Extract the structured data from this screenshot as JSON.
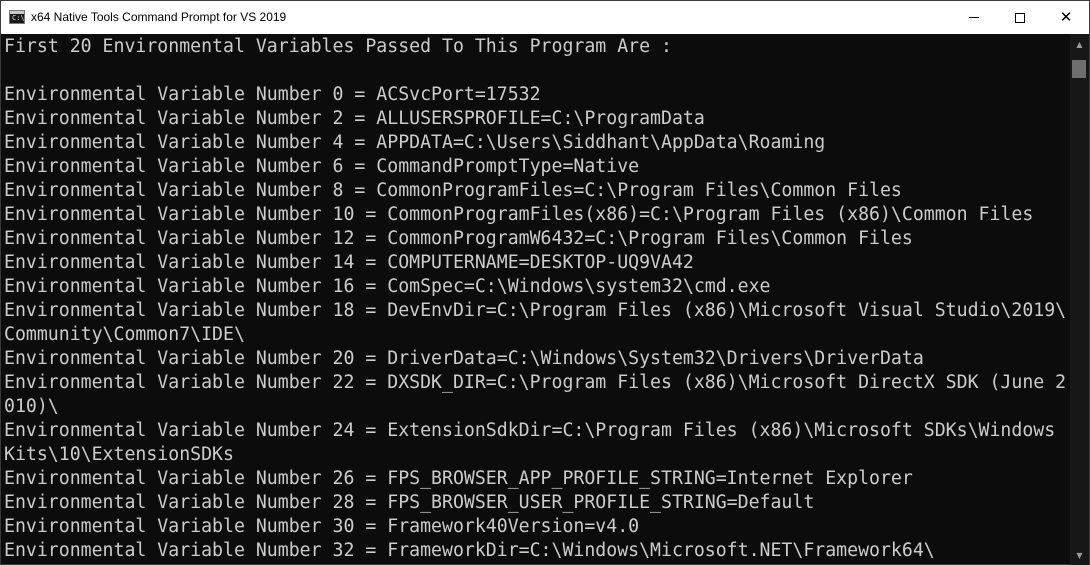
{
  "window": {
    "title": "x64 Native Tools Command Prompt for VS 2019",
    "app_icon": "cmd-icon",
    "controls": {
      "minimize_icon": "minimize-icon",
      "maximize_icon": "maximize-icon",
      "close_icon": "close-icon",
      "close_glyph": "✕"
    },
    "icon_prompt": "C:\\"
  },
  "console": {
    "lines": [
      "First 20 Environmental Variables Passed To This Program Are :",
      "",
      "Environmental Variable Number 0 = ACSvcPort=17532",
      "Environmental Variable Number 2 = ALLUSERSPROFILE=C:\\ProgramData",
      "Environmental Variable Number 4 = APPDATA=C:\\Users\\Siddhant\\AppData\\Roaming",
      "Environmental Variable Number 6 = CommandPromptType=Native",
      "Environmental Variable Number 8 = CommonProgramFiles=C:\\Program Files\\Common Files",
      "Environmental Variable Number 10 = CommonProgramFiles(x86)=C:\\Program Files (x86)\\Common Files",
      "Environmental Variable Number 12 = CommonProgramW6432=C:\\Program Files\\Common Files",
      "Environmental Variable Number 14 = COMPUTERNAME=DESKTOP-UQ9VA42",
      "Environmental Variable Number 16 = ComSpec=C:\\Windows\\system32\\cmd.exe",
      "Environmental Variable Number 18 = DevEnvDir=C:\\Program Files (x86)\\Microsoft Visual Studio\\2019\\",
      "Community\\Common7\\IDE\\",
      "Environmental Variable Number 20 = DriverData=C:\\Windows\\System32\\Drivers\\DriverData",
      "Environmental Variable Number 22 = DXSDK_DIR=C:\\Program Files (x86)\\Microsoft DirectX SDK (June 2",
      "010)\\",
      "Environmental Variable Number 24 = ExtensionSdkDir=C:\\Program Files (x86)\\Microsoft SDKs\\Windows",
      "Kits\\10\\ExtensionSDKs",
      "Environmental Variable Number 26 = FPS_BROWSER_APP_PROFILE_STRING=Internet Explorer",
      "Environmental Variable Number 28 = FPS_BROWSER_USER_PROFILE_STRING=Default",
      "Environmental Variable Number 30 = Framework40Version=v4.0",
      "Environmental Variable Number 32 = FrameworkDir=C:\\Windows\\Microsoft.NET\\Framework64\\"
    ]
  },
  "scrollbar": {
    "up_icon": "scroll-up-arrow-icon",
    "down_icon": "scroll-down-arrow-icon",
    "up_glyph": "▲",
    "down_glyph": "▼"
  },
  "colors": {
    "console_bg": "#0c0c0c",
    "console_text": "#cccccc",
    "titlebar_bg": "#ffffff"
  }
}
